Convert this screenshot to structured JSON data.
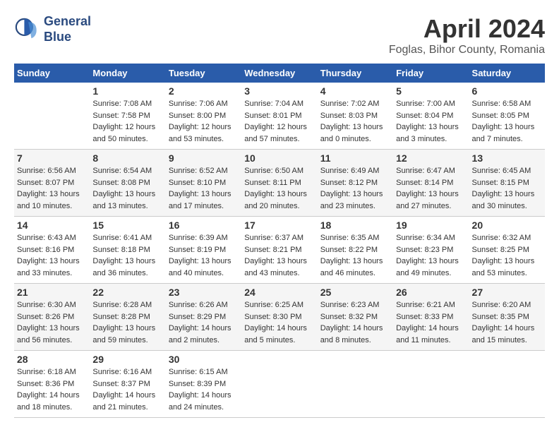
{
  "header": {
    "logo_line1": "General",
    "logo_line2": "Blue",
    "month": "April 2024",
    "location": "Foglas, Bihor County, Romania"
  },
  "days_of_week": [
    "Sunday",
    "Monday",
    "Tuesday",
    "Wednesday",
    "Thursday",
    "Friday",
    "Saturday"
  ],
  "weeks": [
    [
      {
        "day": "",
        "info": ""
      },
      {
        "day": "1",
        "info": "Sunrise: 7:08 AM\nSunset: 7:58 PM\nDaylight: 12 hours\nand 50 minutes."
      },
      {
        "day": "2",
        "info": "Sunrise: 7:06 AM\nSunset: 8:00 PM\nDaylight: 12 hours\nand 53 minutes."
      },
      {
        "day": "3",
        "info": "Sunrise: 7:04 AM\nSunset: 8:01 PM\nDaylight: 12 hours\nand 57 minutes."
      },
      {
        "day": "4",
        "info": "Sunrise: 7:02 AM\nSunset: 8:03 PM\nDaylight: 13 hours\nand 0 minutes."
      },
      {
        "day": "5",
        "info": "Sunrise: 7:00 AM\nSunset: 8:04 PM\nDaylight: 13 hours\nand 3 minutes."
      },
      {
        "day": "6",
        "info": "Sunrise: 6:58 AM\nSunset: 8:05 PM\nDaylight: 13 hours\nand 7 minutes."
      }
    ],
    [
      {
        "day": "7",
        "info": "Sunrise: 6:56 AM\nSunset: 8:07 PM\nDaylight: 13 hours\nand 10 minutes."
      },
      {
        "day": "8",
        "info": "Sunrise: 6:54 AM\nSunset: 8:08 PM\nDaylight: 13 hours\nand 13 minutes."
      },
      {
        "day": "9",
        "info": "Sunrise: 6:52 AM\nSunset: 8:10 PM\nDaylight: 13 hours\nand 17 minutes."
      },
      {
        "day": "10",
        "info": "Sunrise: 6:50 AM\nSunset: 8:11 PM\nDaylight: 13 hours\nand 20 minutes."
      },
      {
        "day": "11",
        "info": "Sunrise: 6:49 AM\nSunset: 8:12 PM\nDaylight: 13 hours\nand 23 minutes."
      },
      {
        "day": "12",
        "info": "Sunrise: 6:47 AM\nSunset: 8:14 PM\nDaylight: 13 hours\nand 27 minutes."
      },
      {
        "day": "13",
        "info": "Sunrise: 6:45 AM\nSunset: 8:15 PM\nDaylight: 13 hours\nand 30 minutes."
      }
    ],
    [
      {
        "day": "14",
        "info": "Sunrise: 6:43 AM\nSunset: 8:16 PM\nDaylight: 13 hours\nand 33 minutes."
      },
      {
        "day": "15",
        "info": "Sunrise: 6:41 AM\nSunset: 8:18 PM\nDaylight: 13 hours\nand 36 minutes."
      },
      {
        "day": "16",
        "info": "Sunrise: 6:39 AM\nSunset: 8:19 PM\nDaylight: 13 hours\nand 40 minutes."
      },
      {
        "day": "17",
        "info": "Sunrise: 6:37 AM\nSunset: 8:21 PM\nDaylight: 13 hours\nand 43 minutes."
      },
      {
        "day": "18",
        "info": "Sunrise: 6:35 AM\nSunset: 8:22 PM\nDaylight: 13 hours\nand 46 minutes."
      },
      {
        "day": "19",
        "info": "Sunrise: 6:34 AM\nSunset: 8:23 PM\nDaylight: 13 hours\nand 49 minutes."
      },
      {
        "day": "20",
        "info": "Sunrise: 6:32 AM\nSunset: 8:25 PM\nDaylight: 13 hours\nand 53 minutes."
      }
    ],
    [
      {
        "day": "21",
        "info": "Sunrise: 6:30 AM\nSunset: 8:26 PM\nDaylight: 13 hours\nand 56 minutes."
      },
      {
        "day": "22",
        "info": "Sunrise: 6:28 AM\nSunset: 8:28 PM\nDaylight: 13 hours\nand 59 minutes."
      },
      {
        "day": "23",
        "info": "Sunrise: 6:26 AM\nSunset: 8:29 PM\nDaylight: 14 hours\nand 2 minutes."
      },
      {
        "day": "24",
        "info": "Sunrise: 6:25 AM\nSunset: 8:30 PM\nDaylight: 14 hours\nand 5 minutes."
      },
      {
        "day": "25",
        "info": "Sunrise: 6:23 AM\nSunset: 8:32 PM\nDaylight: 14 hours\nand 8 minutes."
      },
      {
        "day": "26",
        "info": "Sunrise: 6:21 AM\nSunset: 8:33 PM\nDaylight: 14 hours\nand 11 minutes."
      },
      {
        "day": "27",
        "info": "Sunrise: 6:20 AM\nSunset: 8:35 PM\nDaylight: 14 hours\nand 15 minutes."
      }
    ],
    [
      {
        "day": "28",
        "info": "Sunrise: 6:18 AM\nSunset: 8:36 PM\nDaylight: 14 hours\nand 18 minutes."
      },
      {
        "day": "29",
        "info": "Sunrise: 6:16 AM\nSunset: 8:37 PM\nDaylight: 14 hours\nand 21 minutes."
      },
      {
        "day": "30",
        "info": "Sunrise: 6:15 AM\nSunset: 8:39 PM\nDaylight: 14 hours\nand 24 minutes."
      },
      {
        "day": "",
        "info": ""
      },
      {
        "day": "",
        "info": ""
      },
      {
        "day": "",
        "info": ""
      },
      {
        "day": "",
        "info": ""
      }
    ]
  ]
}
